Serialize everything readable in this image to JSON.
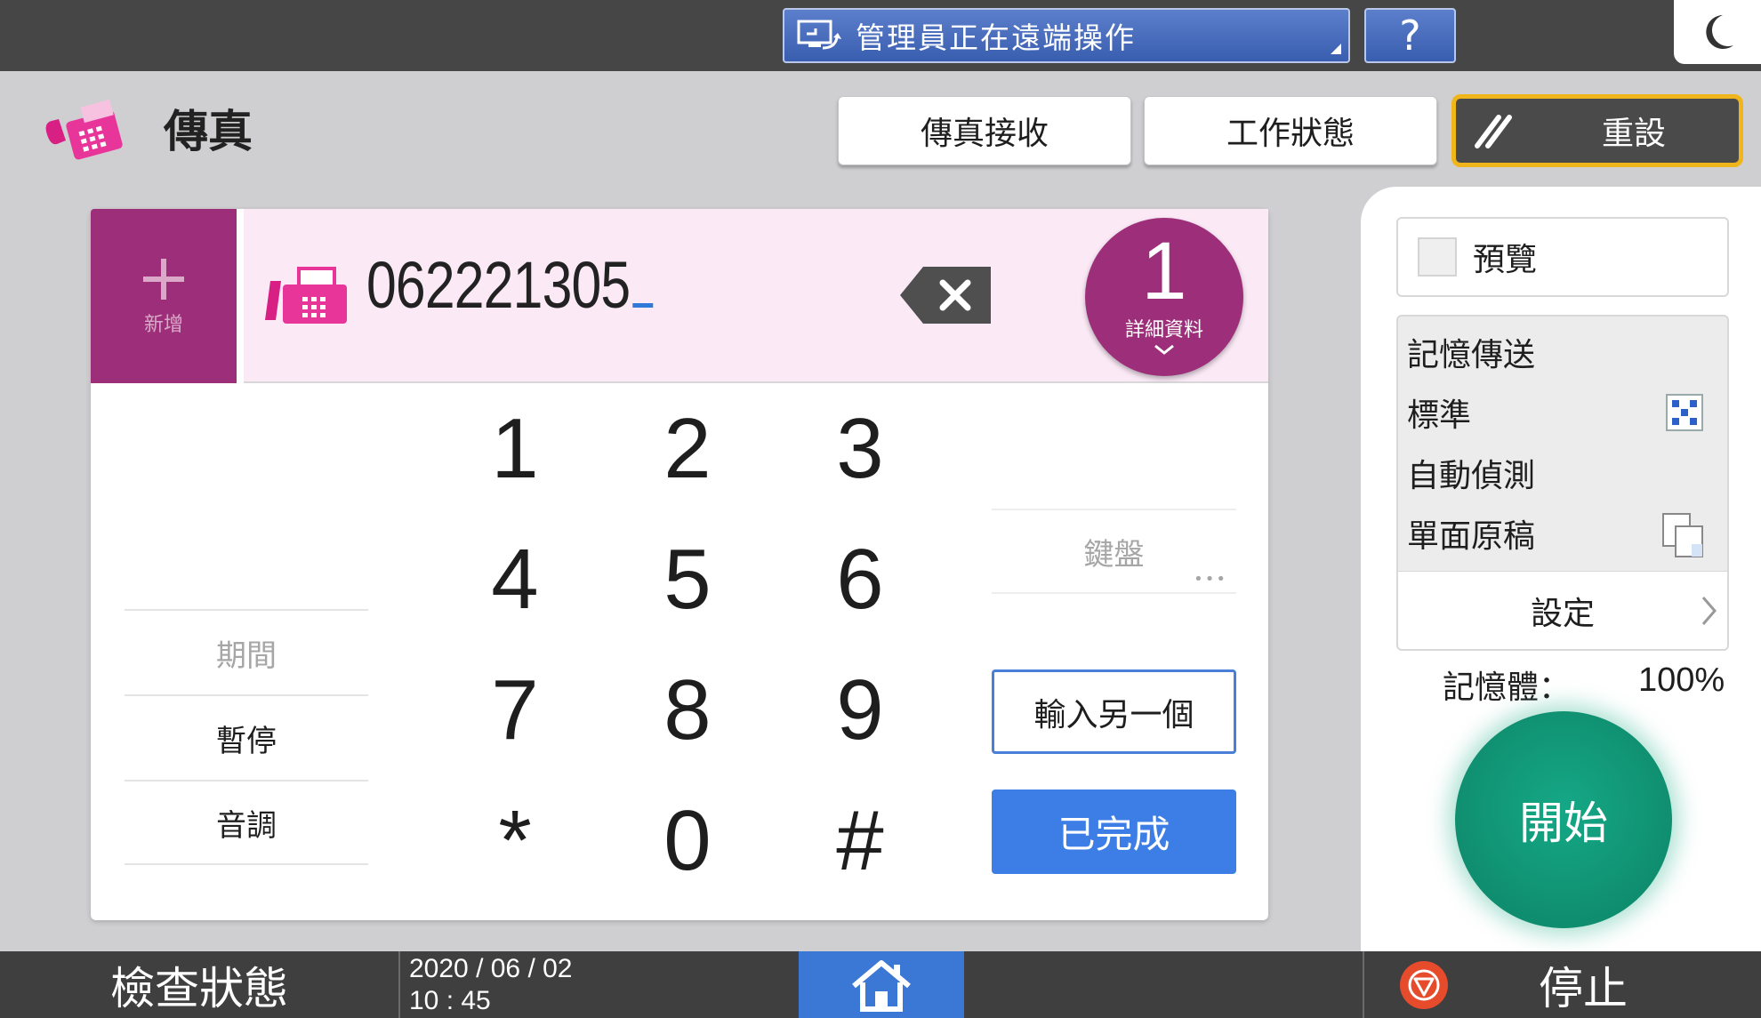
{
  "topbar": {
    "remote_status": "管理員正在遠端操作",
    "help_label": "?"
  },
  "header": {
    "app_title": "傳真",
    "btn_fax_receive": "傳真接收",
    "btn_job_status": "工作狀態",
    "btn_reset": "重設"
  },
  "destination": {
    "add_label": "新增",
    "number": "062221305",
    "count": "1",
    "details_label": "詳細資料"
  },
  "keypad": {
    "keys": [
      "1",
      "2",
      "3",
      "4",
      "5",
      "6",
      "7",
      "8",
      "9",
      "*",
      "0",
      "#"
    ]
  },
  "left_options": {
    "interval": "期間",
    "pause": "暫停",
    "tone": "音調"
  },
  "right_options": {
    "keyboard": "鍵盤",
    "enter_another": "輸入另一個",
    "done": "已完成"
  },
  "settings_panel": {
    "preview_label": "預覽",
    "memory_tx": "記憶傳送",
    "resolution": "標準",
    "density": "自動偵測",
    "original": "單面原稿",
    "settings_label": "設定",
    "memory_label": "記憶體：",
    "memory_value": "100%"
  },
  "start_label": "開始",
  "bottombar": {
    "check_status": "檢查狀態",
    "date": "2020 / 06 / 02",
    "time": "10 : 45",
    "stop_label": "停止"
  },
  "colors": {
    "accent_magenta": "#9d2f7a",
    "accent_blue": "#3d7ee6",
    "start_green": "#0f8e6f",
    "reset_border": "#f1b51c"
  }
}
